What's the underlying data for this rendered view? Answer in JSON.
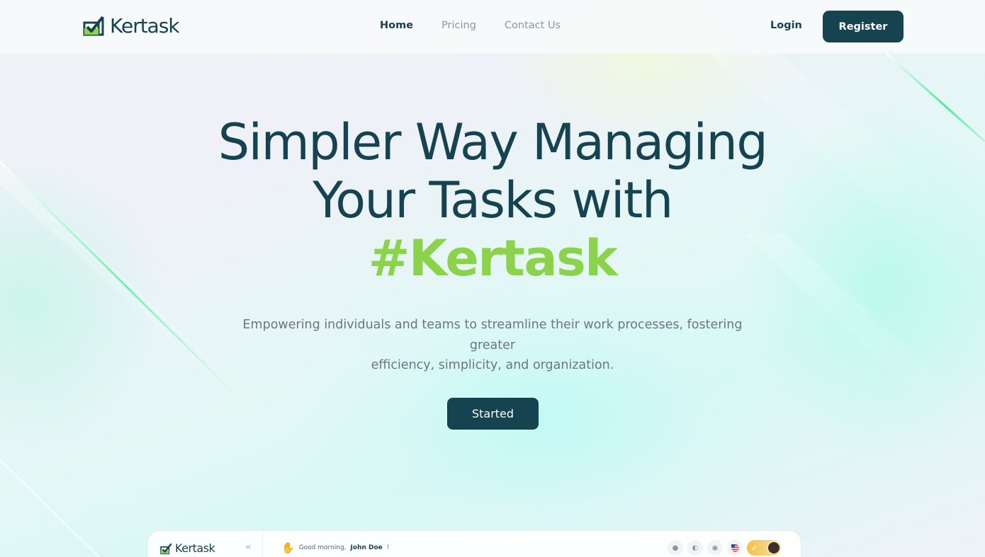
{
  "brand": {
    "name": "Kertask",
    "logo_icon": "check-chart-icon"
  },
  "nav": {
    "items": [
      {
        "label": "Home",
        "active": true
      },
      {
        "label": "Pricing",
        "active": false
      },
      {
        "label": "Contact Us",
        "active": false
      }
    ]
  },
  "auth": {
    "login_label": "Login",
    "register_label": "Register"
  },
  "hero": {
    "title_line1": "Simpler Way Managing",
    "title_line2": "Your Tasks with",
    "title_accent": "#Kertask",
    "subtitle_line1": "Empowering individuals and teams to streamline their work processes, fostering greater",
    "subtitle_line2": "efficiency, simplicity, and organization.",
    "cta_label": "Started"
  },
  "preview": {
    "logo_text": "Kertask",
    "collapse_icon": "double-chevron-left-icon",
    "greeting_prefix": "Good morning, ",
    "greeting_name": "John Doe",
    "greeting_suffix": "!",
    "header_icons": [
      "bell-icon",
      "user-icon",
      "chat-icon",
      "us-flag-icon",
      "rocket-icon",
      "avatar"
    ]
  },
  "colors": {
    "primary": "#15434f",
    "accent": "#8bd34a",
    "muted_text": "#6c7680",
    "nav_inactive": "#8d97a1"
  }
}
